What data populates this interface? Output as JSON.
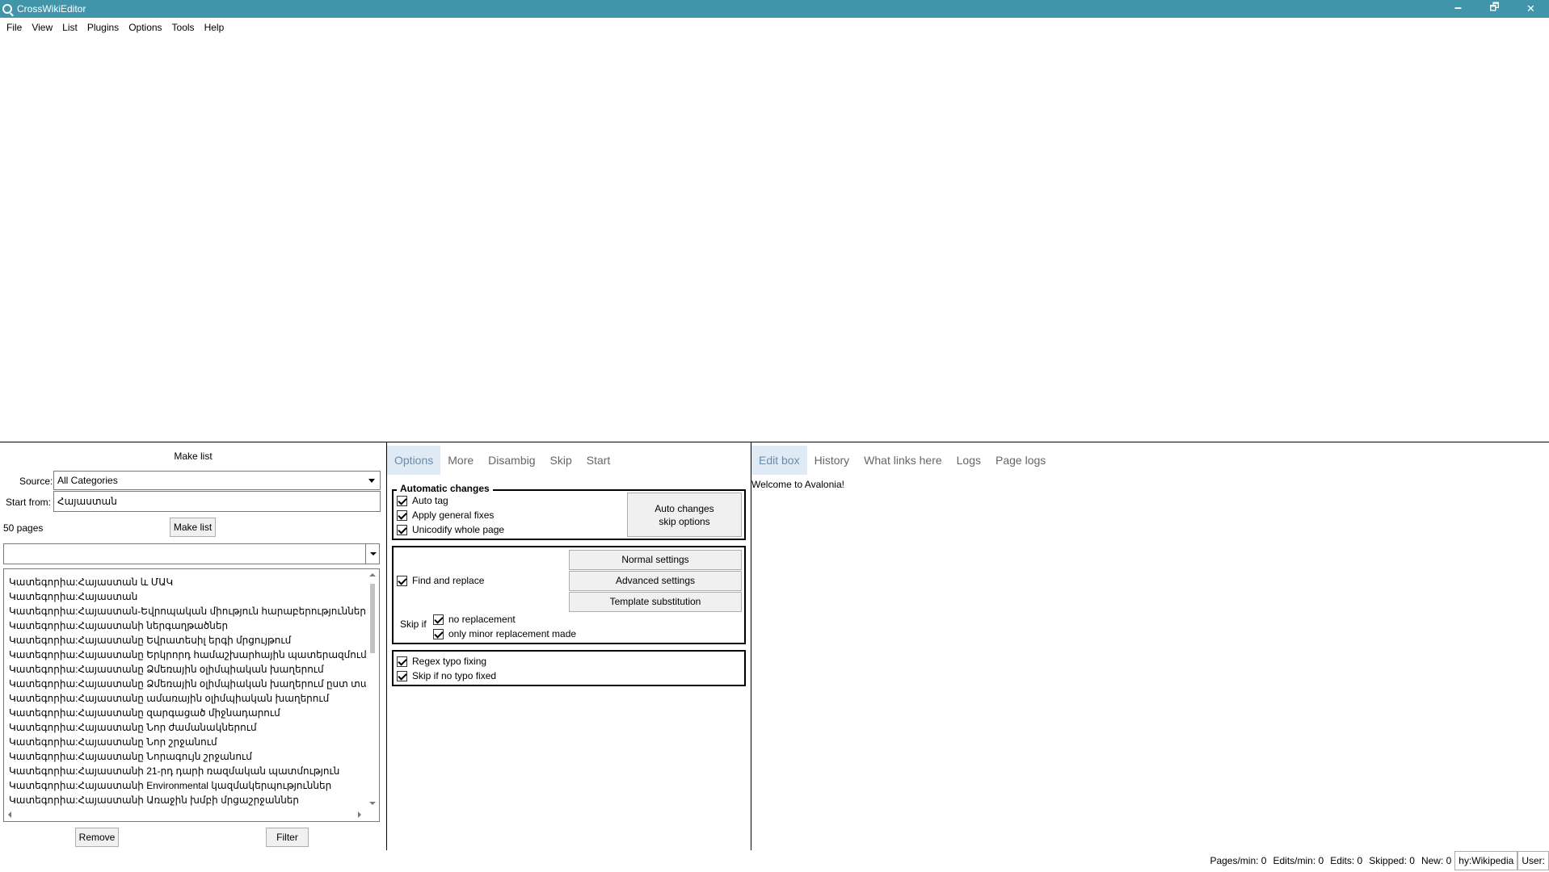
{
  "window": {
    "title": "CrossWikiEditor",
    "minimize": "🗕",
    "maximize": "🗗",
    "close": "✕"
  },
  "menu": [
    "File",
    "View",
    "List",
    "Plugins",
    "Options",
    "Tools",
    "Help"
  ],
  "make_list": {
    "title": "Make list",
    "source_label": "Source:",
    "source_value": "All Categories",
    "start_from_label": "Start from:",
    "start_from_value": "Հայաստան",
    "page_count": "50 pages",
    "make_list_button": "Make list",
    "filter_value": "",
    "items": [
      "Կատեգորիա:Հայաստան և ՄԱԿ",
      "Կատեգորիա:Հայաստան",
      "Կատեգորիա:Հայաստան-Եվրոպական միություն հարաբերություններ",
      "Կատեգորիա:Հայաստանի ներգաղթածներ",
      "Կատեգորիա:Հայաստանը Եվրատեսիլ երգի մրցույթում",
      "Կատեգորիա:Հայաստանը Երկրորդ համաշխարհային պատերազմում",
      "Կատեգորիա:Հայաստանը Ձմեռային օլիմպիական խաղերում",
      "Կատեգորիա:Հայաստանը Ձմեռային օլիմպիական խաղերում ըստ տարեթվի",
      "Կատեգորիա:Հայաստանը ամառային օլիմպիական խաղերում",
      "Կատեգորիա:Հայաստանը զարգացած միջնադարում",
      "Կատեգորիա:Հայաստանը Նոր ժամանակներում",
      "Կատեգորիա:Հայաստանը Նոր շրջանում",
      "Կատեգորիա:Հայաստանը Նորագույն շրջանում",
      "Կատեգորիա:Հայաստանի 21-րդ դարի ռազմական պատմություն",
      "Կատեգորիա:Հայաստանի Environmental կազմակերպություններ",
      "Կատեգորիա:Հայաստանի Առաջին խմբի մրցաշրջաններ"
    ],
    "remove_button": "Remove",
    "filter_button": "Filter"
  },
  "options_tabs": [
    "Options",
    "More",
    "Disambig",
    "Skip",
    "Start"
  ],
  "automatic_changes": {
    "legend": "Automatic changes",
    "auto_tag": "Auto tag",
    "apply_general_fixes": "Apply general fixes",
    "unicodify": "Unicodify whole page",
    "skip_options_button_line1": "Auto changes",
    "skip_options_button_line2": "skip options"
  },
  "find_replace": {
    "label": "Find and replace",
    "normal_settings": "Normal settings",
    "advanced_settings": "Advanced settings",
    "template_substitution": "Template substitution",
    "skip_if": "Skip if",
    "no_replacement": "no replacement",
    "only_minor": "only minor replacement made"
  },
  "typo": {
    "regex_typo": "Regex typo fixing",
    "skip_if_no_typo": "Skip if no typo fixed"
  },
  "edit_tabs": [
    "Edit box",
    "History",
    "What links here",
    "Logs",
    "Page logs"
  ],
  "edit_box_text": "Welcome to Avalonia!",
  "status": {
    "pages_min": "Pages/min: 0",
    "edits_min": "Edits/min: 0",
    "edits": "Edits: 0",
    "skipped": "Skipped: 0",
    "new": "New: 0",
    "project": "hy:Wikipedia",
    "user": "User:"
  }
}
